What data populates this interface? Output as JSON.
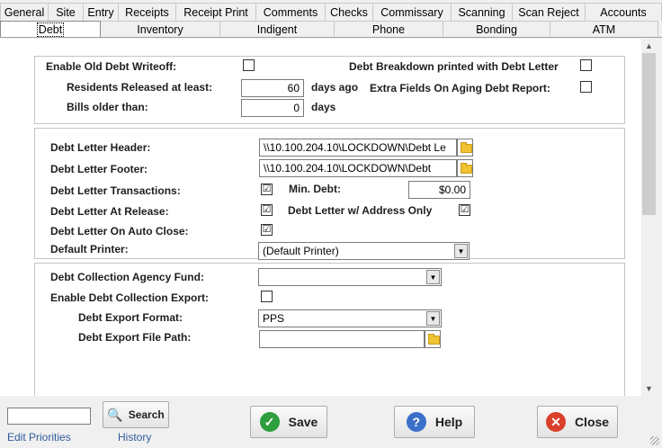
{
  "tabs_row1": [
    "General",
    "Site",
    "Entry",
    "Receipts",
    "Receipt Print",
    "Comments",
    "Checks",
    "Commissary",
    "Scanning",
    "Scan Reject",
    "Accounts"
  ],
  "tabs_row2": [
    "Debt",
    "Inventory",
    "Indigent",
    "Phone",
    "Bonding",
    "ATM"
  ],
  "active_tab": "Debt",
  "section1": {
    "enable_old_debt_writeoff": {
      "label": "Enable Old Debt Writeoff:",
      "checked": false
    },
    "debt_breakdown": {
      "label": "Debt Breakdown printed with Debt Letter",
      "checked": false
    },
    "residents_released": {
      "label": "Residents Released at least:",
      "value": "60",
      "suffix": "days ago"
    },
    "extra_fields": {
      "label": "Extra Fields On Aging Debt Report:",
      "checked": false
    },
    "bills_older": {
      "label": "Bills older than:",
      "value": "0",
      "suffix": "days"
    }
  },
  "section2": {
    "header": {
      "label": "Debt Letter Header:",
      "value": "\\\\10.100.204.10\\LOCKDOWN\\Debt Le"
    },
    "footer": {
      "label": "Debt Letter Footer:",
      "value": "\\\\10.100.204.10\\LOCKDOWN\\Debt"
    },
    "transactions": {
      "label": "Debt Letter Transactions:",
      "checked": true
    },
    "min_debt": {
      "label": "Min. Debt:",
      "value": "$0.00"
    },
    "at_release": {
      "label": "Debt Letter At Release:",
      "checked": true
    },
    "address_only": {
      "label": "Debt Letter w/ Address Only",
      "checked": true
    },
    "auto_close": {
      "label": "Debt Letter On Auto Close:",
      "checked": true
    },
    "default_printer": {
      "label": "Default Printer:",
      "value": "(Default Printer)"
    }
  },
  "section3": {
    "agency_fund": {
      "label": "Debt Collection Agency Fund:",
      "value": ""
    },
    "enable_export": {
      "label": "Enable Debt Collection Export:",
      "checked": false
    },
    "export_format": {
      "label": "Debt Export Format:",
      "value": "PPS"
    },
    "export_path": {
      "label": "Debt Export File Path:",
      "value": ""
    }
  },
  "bottom": {
    "search_value": "",
    "search_label": "Search",
    "save_label": "Save",
    "help_label": "Help",
    "close_label": "Close",
    "edit_priorities": "Edit Priorities",
    "history": "History"
  },
  "check_glyph": "☑",
  "colors": {
    "save": "#2e9e3e",
    "help": "#3b6fc9",
    "close": "#d9412b",
    "link": "#2f5b9c"
  },
  "icons": {
    "save": "check-icon",
    "help": "question-icon",
    "close": "x-icon",
    "search": "magnifier-icon",
    "folder": "folder-icon"
  }
}
